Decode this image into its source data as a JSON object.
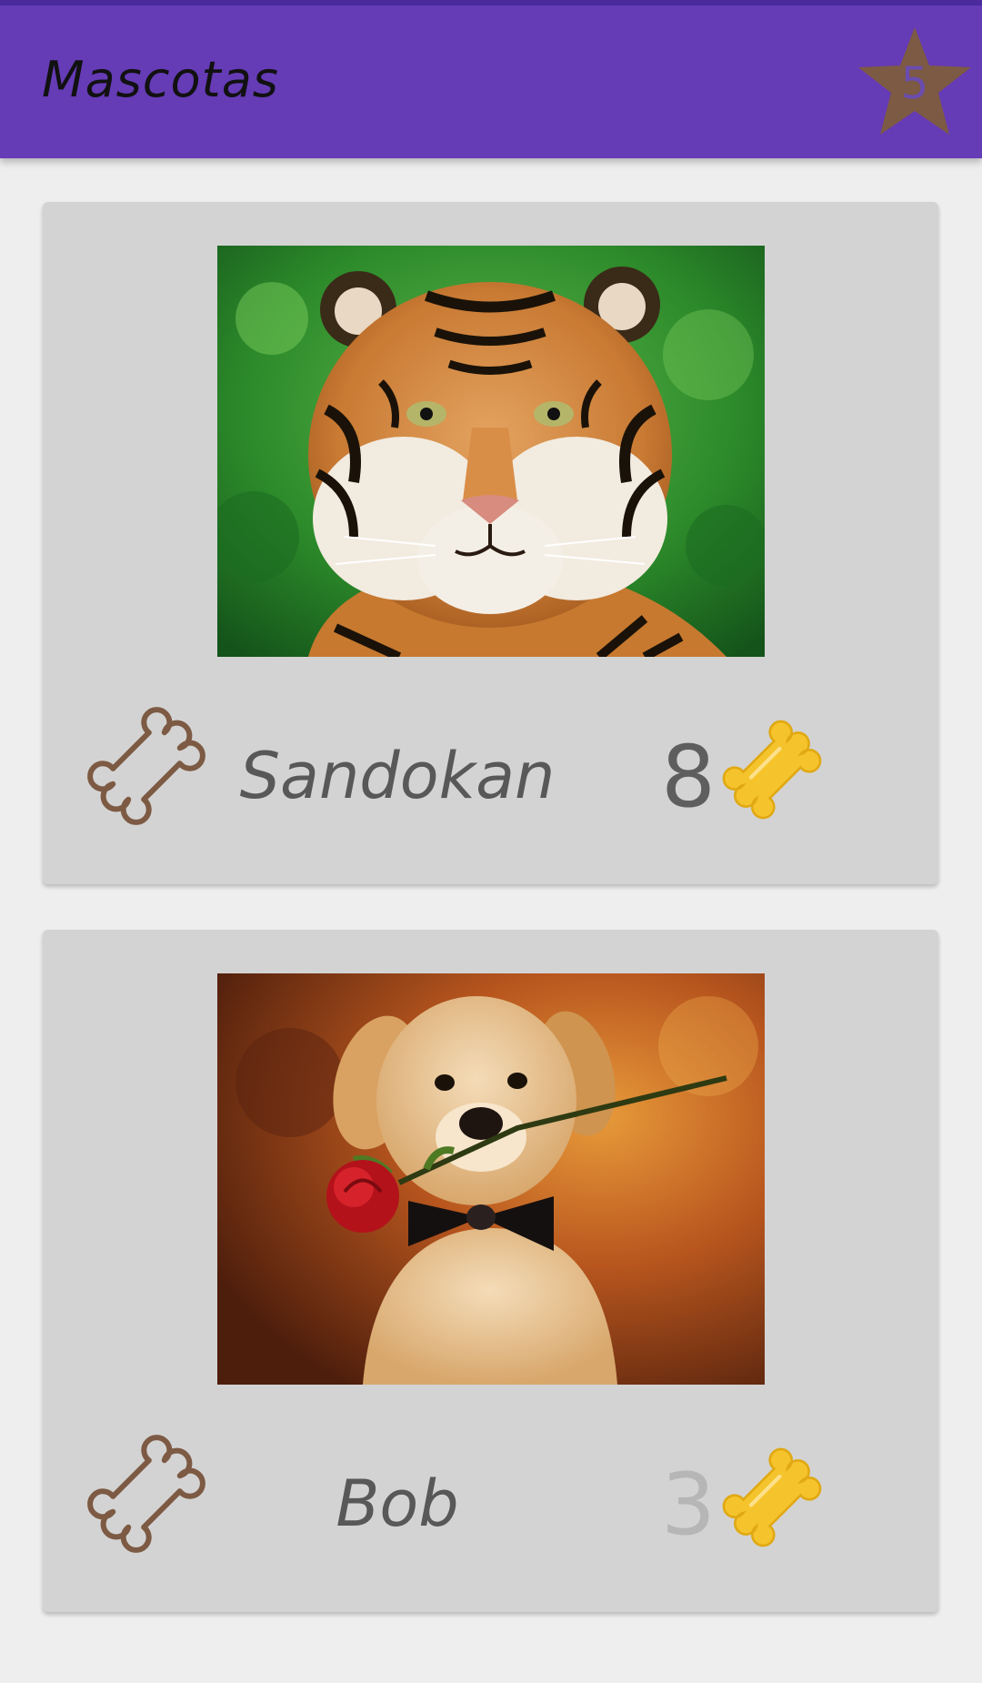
{
  "app": {
    "title": "Mascotas",
    "favorites_count": "5",
    "colors": {
      "app_bar": "#653bb6",
      "star": "#7d5a43",
      "bone_outline": "#7d5a43",
      "bone_filled": "#f5c32b"
    }
  },
  "pets": [
    {
      "name": "Sandokan",
      "rating": "8",
      "photo": "tiger-photo",
      "like_icon": "bone-outline-icon",
      "rating_icon": "bone-filled-icon"
    },
    {
      "name": "Bob",
      "rating": "3",
      "photo": "puppy-with-rose-photo",
      "like_icon": "bone-outline-icon",
      "rating_icon": "bone-filled-icon"
    }
  ]
}
